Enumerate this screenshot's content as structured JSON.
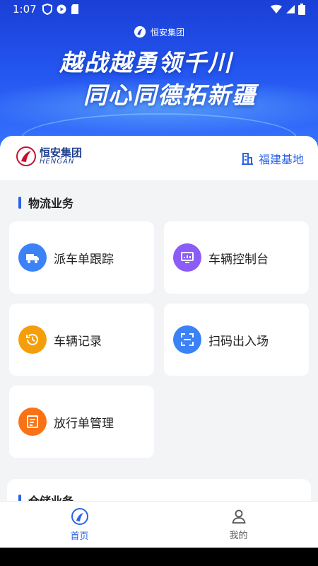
{
  "status": {
    "time": "1:07"
  },
  "banner": {
    "brand_small": "恒安集团",
    "slogan_line1": "越战越勇领千川",
    "slogan_line2": "同心同德拓新疆"
  },
  "header": {
    "brand_cn": "恒安集团",
    "brand_en": "HENGAN",
    "base_name": "福建基地"
  },
  "logistics": {
    "title": "物流业务",
    "items": [
      {
        "label": "派车单跟踪",
        "icon": "truck-icon",
        "color": "#3b82f6"
      },
      {
        "label": "车辆控制台",
        "icon": "console-icon",
        "color": "#8b5cf6"
      },
      {
        "label": "车辆记录",
        "icon": "history-icon",
        "color": "#f59e0b"
      },
      {
        "label": "扫码出入场",
        "icon": "scan-icon",
        "color": "#3b82f6"
      },
      {
        "label": "放行单管理",
        "icon": "release-doc-icon",
        "color": "#f97316"
      }
    ]
  },
  "warehouse": {
    "title": "仓储业务"
  },
  "tabbar": {
    "home_label": "首页",
    "mine_label": "我的"
  },
  "colors": {
    "accent": "#2b63e8"
  }
}
